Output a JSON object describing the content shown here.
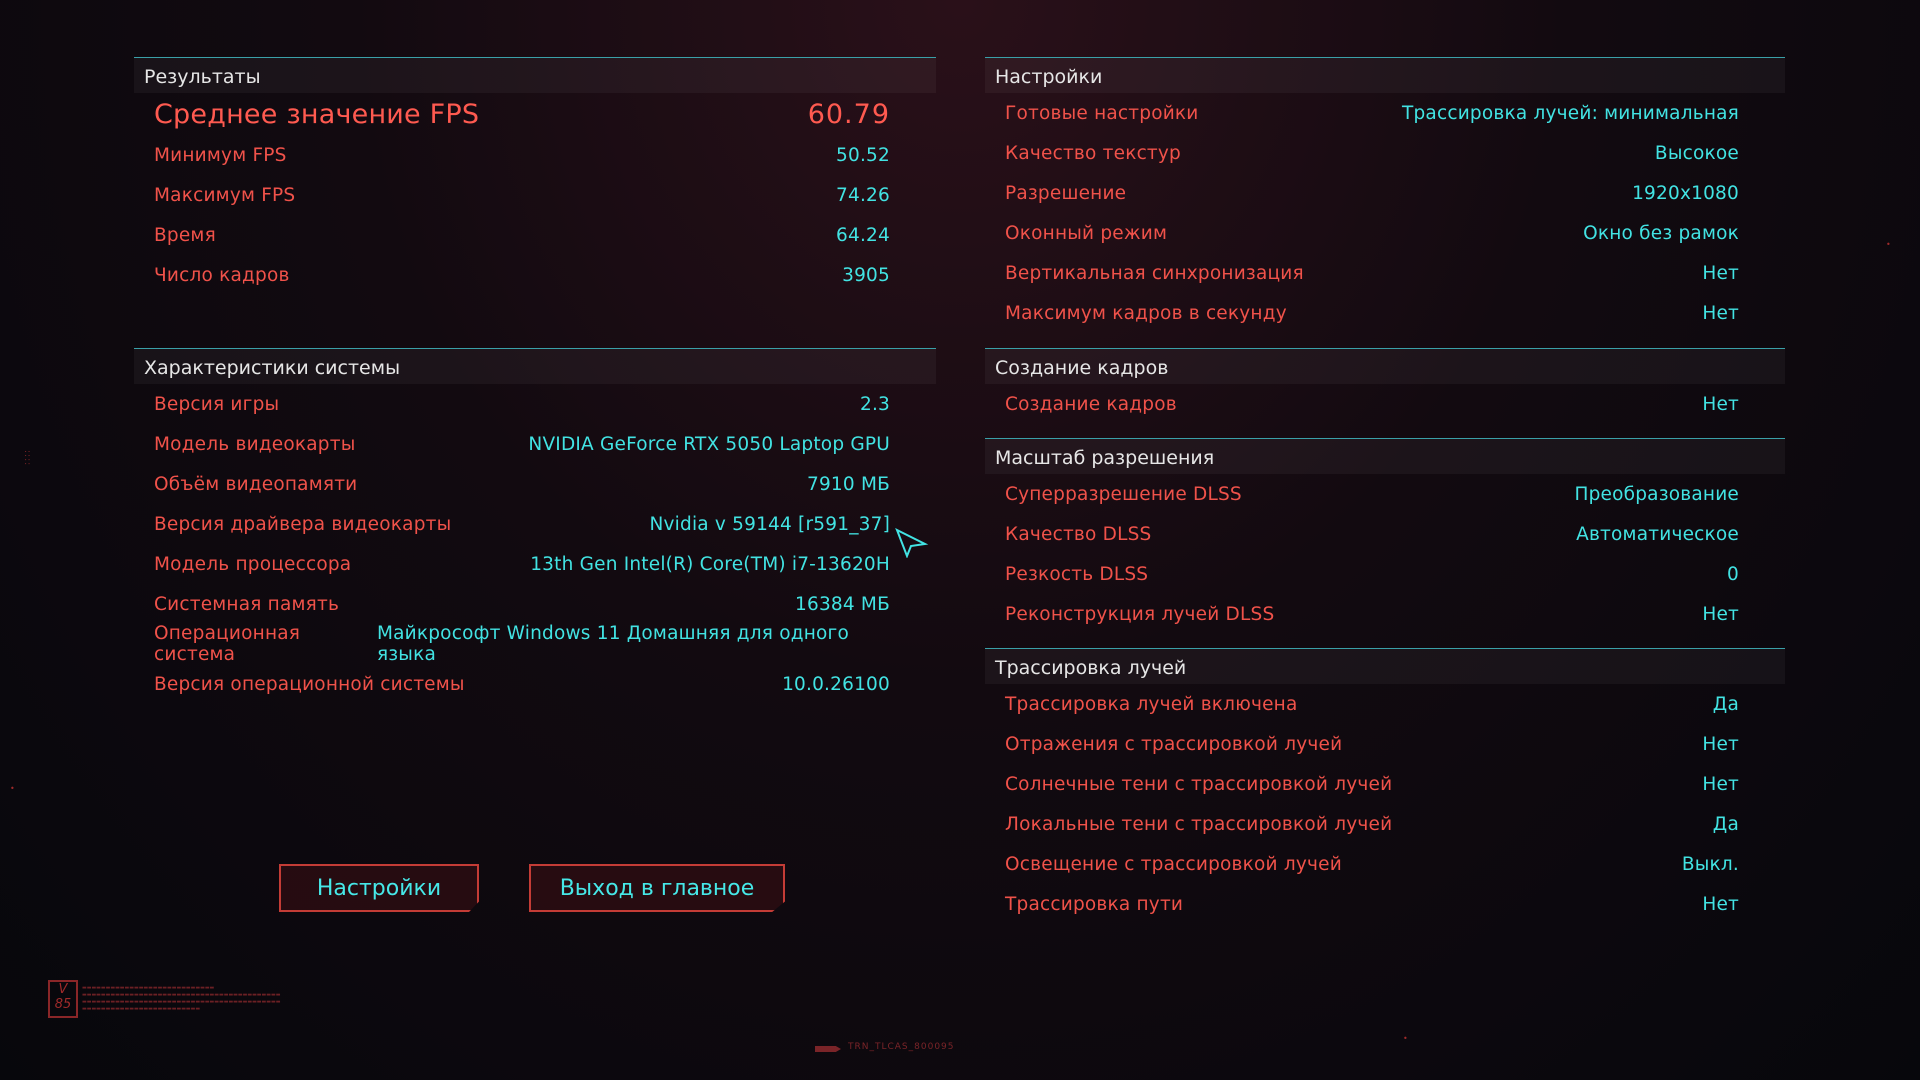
{
  "results": {
    "header": "Результаты",
    "avg_fps_label": "Среднее значение FPS",
    "avg_fps_value": "60.79",
    "rows": [
      {
        "label": "Минимум FPS",
        "value": "50.52"
      },
      {
        "label": "Максимум FPS",
        "value": "74.26"
      },
      {
        "label": "Время",
        "value": "64.24"
      },
      {
        "label": "Число кадров",
        "value": "3905"
      }
    ]
  },
  "system": {
    "header": "Характеристики системы",
    "rows": [
      {
        "label": "Версия игры",
        "value": "2.3"
      },
      {
        "label": "Модель видеокарты",
        "value": "NVIDIA GeForce RTX 5050 Laptop GPU"
      },
      {
        "label": "Объём видеопамяти",
        "value": "7910 МБ"
      },
      {
        "label": "Версия драйвера видеокарты",
        "value": "Nvidia v 59144 [r591_37]"
      },
      {
        "label": "Модель процессора",
        "value": "13th Gen Intel(R) Core(TM) i7-13620H"
      },
      {
        "label": "Системная память",
        "value": "16384 МБ"
      },
      {
        "label": "Операционная система",
        "value": "Майкрософт Windows 11 Домашняя для одного языка"
      },
      {
        "label": "Версия операционной системы",
        "value": "10.0.26100"
      }
    ]
  },
  "settings": {
    "header": "Настройки",
    "rows": [
      {
        "label": "Готовые настройки",
        "value": "Трассировка лучей: минимальная"
      },
      {
        "label": "Качество текстур",
        "value": "Высокое"
      },
      {
        "label": "Разрешение",
        "value": "1920x1080"
      },
      {
        "label": "Оконный режим",
        "value": "Окно без рамок"
      },
      {
        "label": "Вертикальная синхронизация",
        "value": "Нет"
      },
      {
        "label": "Максимум кадров в секунду",
        "value": "Нет"
      }
    ]
  },
  "frame_gen": {
    "header": "Создание кадров",
    "rows": [
      {
        "label": "Создание кадров",
        "value": "Нет"
      }
    ]
  },
  "resolution_scaling": {
    "header": "Масштаб разрешения",
    "rows": [
      {
        "label": "Суперразрешение DLSS",
        "value": "Преобразование"
      },
      {
        "label": "Качество DLSS",
        "value": "Автоматическое"
      },
      {
        "label": "Резкость DLSS",
        "value": "0"
      },
      {
        "label": "Реконструкция лучей DLSS",
        "value": "Нет"
      }
    ]
  },
  "ray_tracing": {
    "header": "Трассировка лучей",
    "rows": [
      {
        "label": "Трассировка лучей включена",
        "value": "Да"
      },
      {
        "label": "Отражения с трассировкой лучей",
        "value": "Нет"
      },
      {
        "label": "Солнечные тени с трассировкой лучей",
        "value": "Нет"
      },
      {
        "label": "Локальные тени с трассировкой лучей",
        "value": "Да"
      },
      {
        "label": "Освещение с трассировкой лучей",
        "value": "Выкл."
      },
      {
        "label": "Трассировка пути",
        "value": "Нет"
      }
    ]
  },
  "buttons": {
    "settings": "Настройки",
    "exit": "Выход в главное меню"
  },
  "decor": {
    "footer_code": "TRN_TLCAS_800095",
    "logo_v": "V",
    "logo_num": "85"
  },
  "colors": {
    "label_red": "#f0524a",
    "value_cyan": "#42e3e3",
    "divider_teal": "#3aa0a8",
    "button_border": "#c43c36"
  }
}
